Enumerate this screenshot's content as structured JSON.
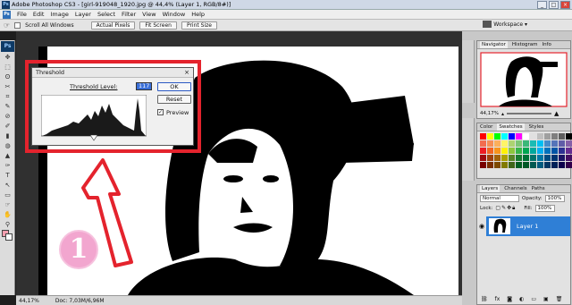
{
  "window": {
    "app_icon": "Ps",
    "title": "Adobe Photoshop CS3 - [girl-919048_1920.jpg @ 44,4% (Layer 1, RGB/8#)]",
    "min": "_",
    "max": "□",
    "close": "×"
  },
  "menu": {
    "logo": "Ps",
    "items": [
      "File",
      "Edit",
      "Image",
      "Layer",
      "Select",
      "Filter",
      "View",
      "Window",
      "Help"
    ],
    "workspace": "Workspace ▾"
  },
  "options": {
    "scroll_all": "Scroll All Windows",
    "actual_pixels": "Actual Pixels",
    "fit_screen": "Fit Screen",
    "print_size": "Print Size"
  },
  "toolbox": {
    "logo": "Ps",
    "tools": [
      "✥",
      "⬚",
      "ʘ",
      "✂",
      "⌗",
      "✎",
      "⊘",
      "✐",
      "▮",
      "◍",
      "▲",
      "✑",
      "T",
      "↖",
      "▭",
      "☞",
      "✋",
      "⚲"
    ]
  },
  "status": {
    "zoom": "44,17%",
    "doc": "Doc: 7,03M/6,96M"
  },
  "threshold": {
    "title": "Threshold",
    "close": "×",
    "level_label": "Threshold Level:",
    "level_value": "117",
    "ok": "OK",
    "reset": "Reset",
    "preview": "Preview",
    "preview_checked": true
  },
  "annotation": {
    "number": "1"
  },
  "navigator": {
    "tabs": [
      "Navigator",
      "Histogram",
      "Info"
    ],
    "zoom": "44,17%"
  },
  "swatches": {
    "tabs": [
      "Color",
      "Swatches",
      "Styles"
    ]
  },
  "layers": {
    "tabs": [
      "Layers",
      "Channels",
      "Paths"
    ],
    "blend_mode": "Normal",
    "opacity_label": "Opacity:",
    "opacity": "100%",
    "lock_label": "Lock:",
    "fill_label": "Fill:",
    "fill": "100%",
    "layer_name": "Layer 1"
  },
  "colors": {
    "red_annotation": "#e4232d",
    "layer_selected": "#2f7fd6",
    "badge": "#f2a6cf"
  }
}
